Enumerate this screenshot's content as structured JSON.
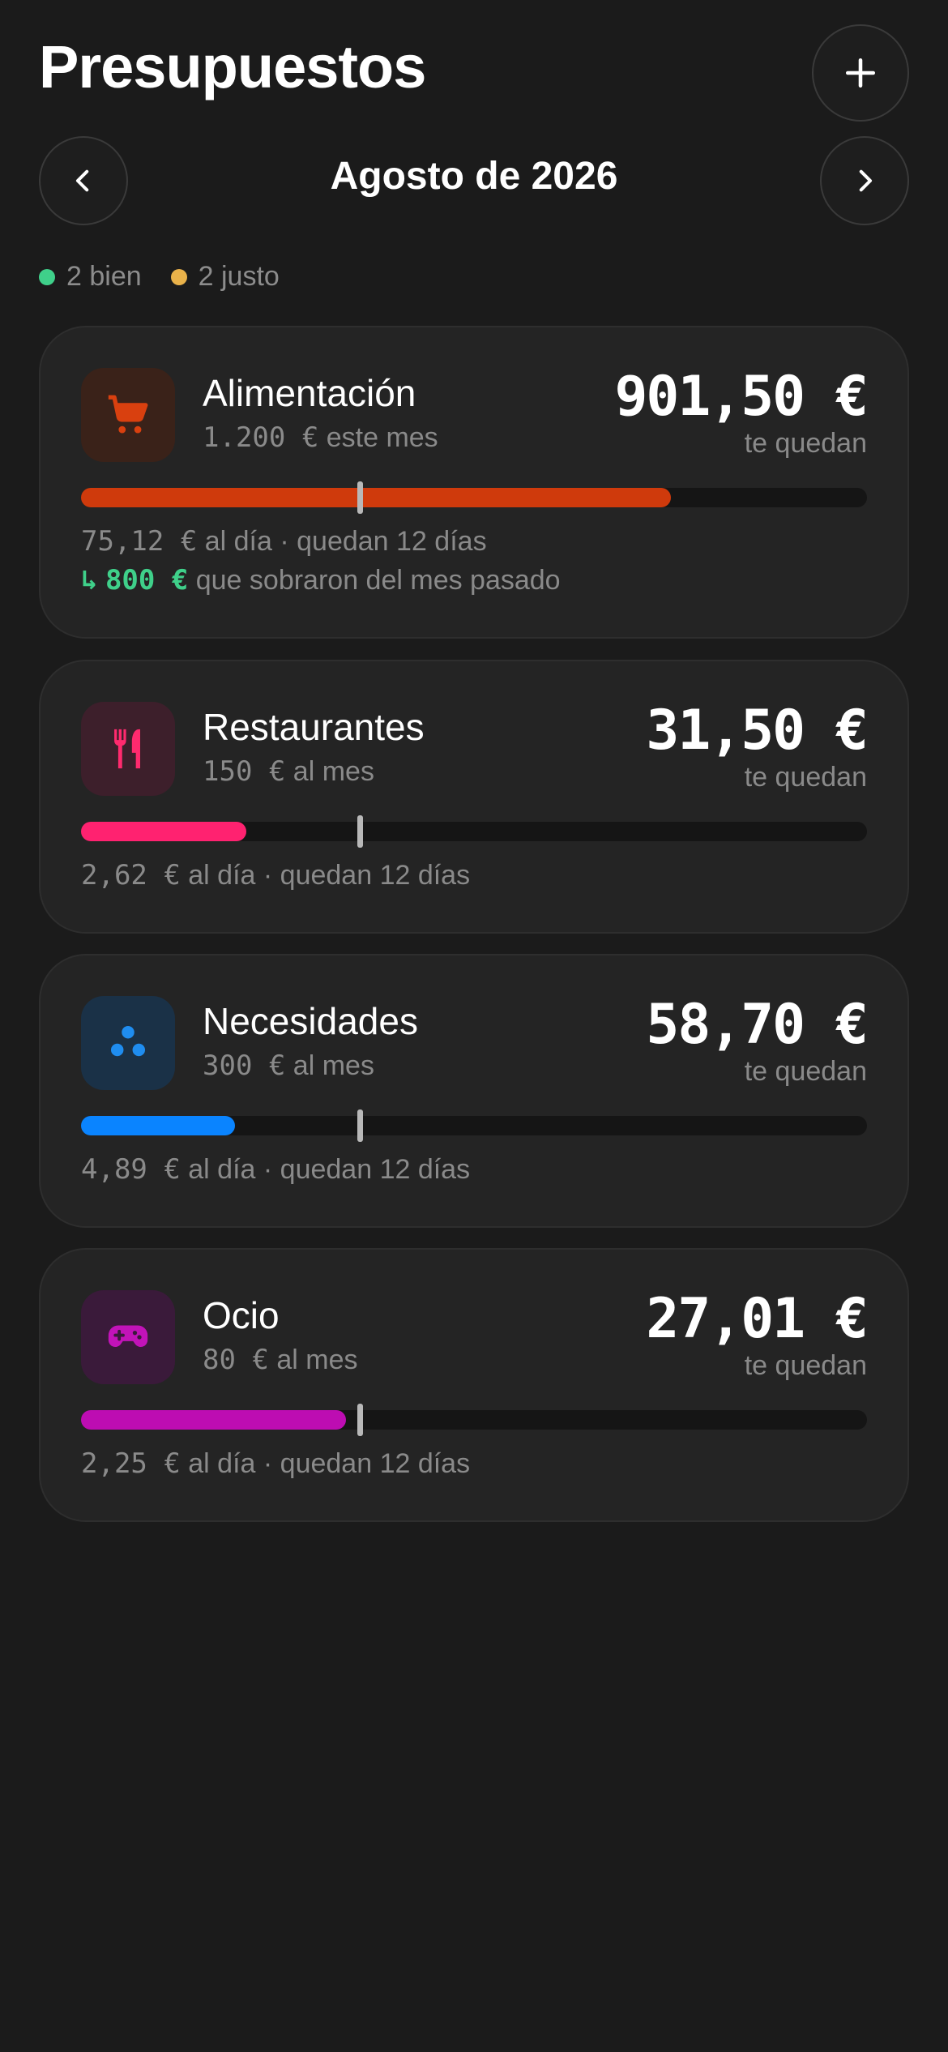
{
  "header": {
    "title": "Presupuestos",
    "add_icon": "plus-icon"
  },
  "month_nav": {
    "label": "Agosto de 2026",
    "prev_icon": "chevron-left-icon",
    "next_icon": "chevron-right-icon"
  },
  "legend": [
    {
      "text": "2 bien",
      "color": "#3fd08a"
    },
    {
      "text": "2 justo",
      "color": "#e9b24a"
    }
  ],
  "budgets": [
    {
      "name": "Alimentación",
      "sub_amount": "1.200 €",
      "sub_suffix": " este mes",
      "remaining": "901,50 €",
      "remaining_caption": "te quedan",
      "icon": "shopping-cart-icon",
      "icon_color": "#d9400f",
      "icon_bg": "#3a2219",
      "bar_color": "#cf3a0c",
      "progress": 0.75,
      "daily_amount": "75,12 €",
      "daily_suffix": " al día · quedan 12 días",
      "rollover_arrow": "↳",
      "rollover_amount": "800 €",
      "rollover_text": " que sobraron del mes pasado"
    },
    {
      "name": "Restaurantes",
      "sub_amount": "150 €",
      "sub_suffix": " al mes",
      "remaining": "31,50 €",
      "remaining_caption": "te quedan",
      "icon": "fork-knife-icon",
      "icon_color": "#ff2a6e",
      "icon_bg": "#3d1f2b",
      "bar_color": "#ff2270",
      "progress": 0.21,
      "daily_amount": "2,62 €",
      "daily_suffix": " al día · quedan 12 días"
    },
    {
      "name": "Necesidades",
      "sub_amount": "300 €",
      "sub_suffix": " al mes",
      "remaining": "58,70 €",
      "remaining_caption": "te quedan",
      "icon": "three-dots-icon",
      "icon_color": "#1f8df0",
      "icon_bg": "#1a3147",
      "bar_color": "#0a84ff",
      "progress": 0.196,
      "daily_amount": "4,89 €",
      "daily_suffix": " al día · quedan 12 días"
    },
    {
      "name": "Ocio",
      "sub_amount": "80 €",
      "sub_suffix": " al mes",
      "remaining": "27,01 €",
      "remaining_caption": "te quedan",
      "icon": "gamepad-icon",
      "icon_color": "#c213b8",
      "icon_bg": "#3a1a3a",
      "bar_color": "#bd0db2",
      "progress": 0.337,
      "daily_amount": "2,25 €",
      "daily_suffix": " al día · quedan 12 días"
    }
  ],
  "month_progress": 0.355
}
